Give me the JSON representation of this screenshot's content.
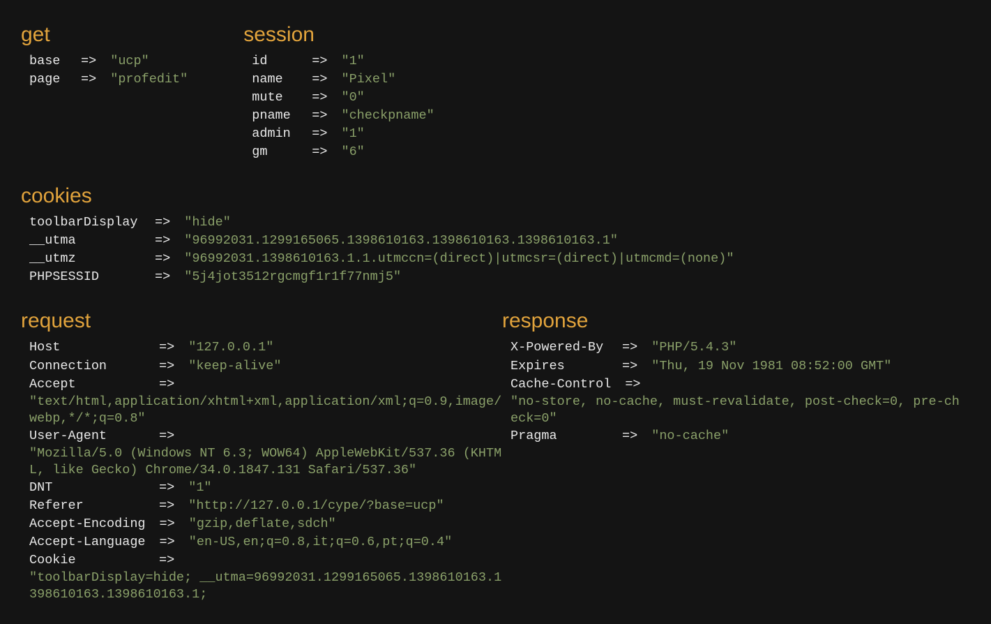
{
  "sections": {
    "get": {
      "title": "get",
      "items": [
        {
          "key": "base",
          "value": "\"ucp\""
        },
        {
          "key": "page",
          "value": "\"profedit\""
        }
      ]
    },
    "session": {
      "title": "session",
      "items": [
        {
          "key": "id",
          "value": "\"1\""
        },
        {
          "key": "name",
          "value": "\"Pixel\""
        },
        {
          "key": "mute",
          "value": "\"0\""
        },
        {
          "key": "pname",
          "value": "\"checkpname\""
        },
        {
          "key": "admin",
          "value": "\"1\""
        },
        {
          "key": "gm",
          "value": "\"6\""
        }
      ]
    },
    "cookies": {
      "title": "cookies",
      "items": [
        {
          "key": "toolbarDisplay",
          "value": "\"hide\""
        },
        {
          "key": "__utma",
          "value": "\"96992031.1299165065.1398610163.1398610163.1398610163.1\""
        },
        {
          "key": "__utmz",
          "value": "\"96992031.1398610163.1.1.utmccn=(direct)|utmcsr=(direct)|utmcmd=(none)\""
        },
        {
          "key": "PHPSESSID",
          "value": "\"5j4jot3512rgcmgf1r1f77nmj5\""
        }
      ]
    },
    "request": {
      "title": "request",
      "items": [
        {
          "key": "Host",
          "value": "\"127.0.0.1\""
        },
        {
          "key": "Connection",
          "value": "\"keep-alive\""
        },
        {
          "key": "Accept",
          "value": "",
          "wrap": "\"text/html,application/xhtml+xml,application/xml;q=0.9,image/webp,*/*;q=0.8\""
        },
        {
          "key": "User-Agent",
          "value": "",
          "wrap": "\"Mozilla/5.0 (Windows NT 6.3; WOW64) AppleWebKit/537.36 (KHTML, like Gecko) Chrome/34.0.1847.131 Safari/537.36\""
        },
        {
          "key": "DNT",
          "value": "\"1\""
        },
        {
          "key": "Referer",
          "value": "\"http://127.0.0.1/cype/?base=ucp\""
        },
        {
          "key": "Accept-Encoding",
          "value": "\"gzip,deflate,sdch\""
        },
        {
          "key": "Accept-Language",
          "value": "\"en-US,en;q=0.8,it;q=0.6,pt;q=0.4\""
        },
        {
          "key": "Cookie",
          "value": "",
          "wrap": "\"toolbarDisplay=hide; __utma=96992031.1299165065.1398610163.1398610163.1398610163.1;"
        }
      ]
    },
    "response": {
      "title": "response",
      "items": [
        {
          "key": "X-Powered-By",
          "value": "\"PHP/5.4.3\""
        },
        {
          "key": "Expires",
          "value": "\"Thu, 19 Nov 1981 08:52:00 GMT\""
        },
        {
          "key": "Cache-Control",
          "value": "",
          "wrap": "\"no-store, no-cache, must-revalidate, post-check=0, pre-check=0\""
        },
        {
          "key": "Pragma",
          "value": "\"no-cache\""
        }
      ]
    }
  },
  "arrow": "=>"
}
